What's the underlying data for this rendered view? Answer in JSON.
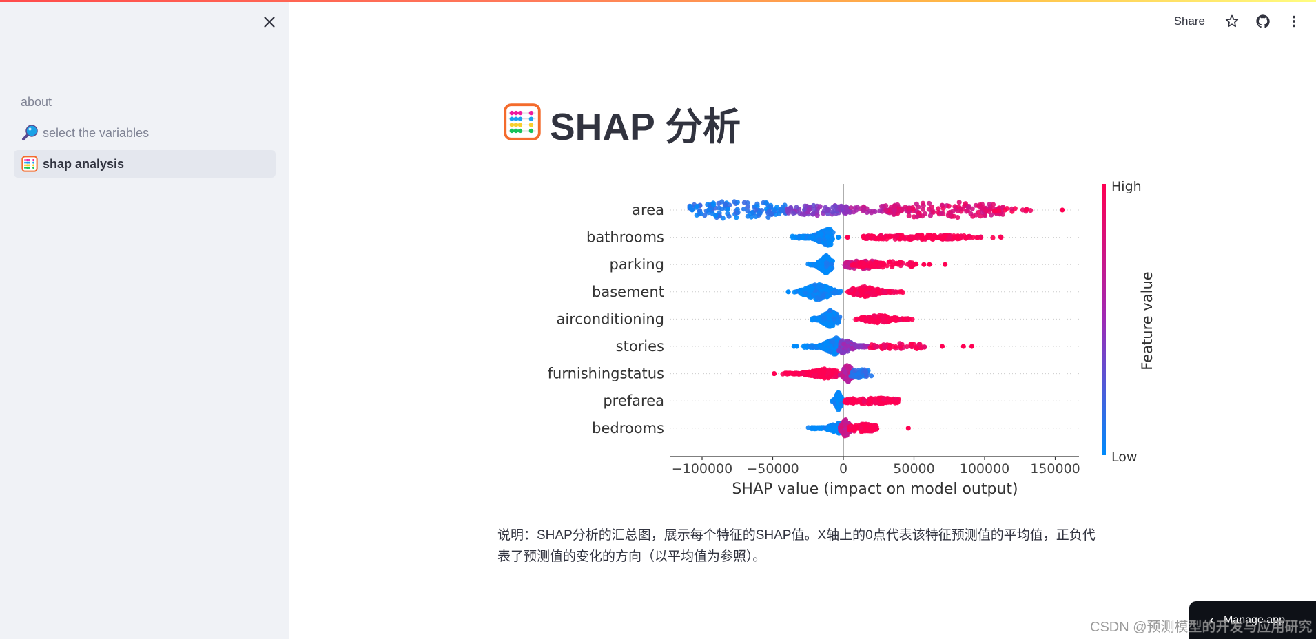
{
  "sidebar": {
    "close_icon": "close-icon",
    "items": [
      {
        "label": "about",
        "icon": "",
        "active": false
      },
      {
        "label": "select the variables",
        "icon": "magnifier-icon",
        "active": false
      },
      {
        "label": "shap analysis",
        "icon": "abacus-icon",
        "active": true
      }
    ]
  },
  "header": {
    "share_label": "Share",
    "icons": [
      "star-icon",
      "github-icon",
      "more-vertical-icon"
    ]
  },
  "page": {
    "title": "SHAP 分析",
    "title_icon": "abacus-icon",
    "description": "说明：SHAP分析的汇总图，展示每个特征的SHAP值。X轴上的0点代表该特征预测值的平均值，正负代表了预测值的变化的方向（以平均值为参照）。"
  },
  "footer": {
    "manage_app_label": "Manage app",
    "watermark": "CSDN @预测模型的开发与应用研究"
  },
  "colors": {
    "low": "#008bfb",
    "mid": "#9e2ab5",
    "high": "#ff0052",
    "accent": "#ff4b4b"
  },
  "chart_data": {
    "type": "scatter",
    "subtype": "shap-beeswarm-summary",
    "xlabel": "SHAP value (impact on model output)",
    "ylabel": "",
    "xlim": [
      -123000,
      166000
    ],
    "xticks": [
      -100000,
      -50000,
      0,
      50000,
      100000,
      150000
    ],
    "xtick_labels": [
      "−100000",
      "−50000",
      "0",
      "50000",
      "100000",
      "150000"
    ],
    "colorbar": {
      "label": "Feature value",
      "high_label": "High",
      "low_label": "Low",
      "placement": "right"
    },
    "features": [
      {
        "name": "area",
        "groups": [
          {
            "from": -109000,
            "to": -40000,
            "n": 130,
            "color": 0.1,
            "spread": 1.0
          },
          {
            "from": -40000,
            "to": 5000,
            "n": 90,
            "color": 0.4,
            "spread": 0.6
          },
          {
            "from": 5000,
            "to": 50000,
            "n": 40,
            "color": 0.65,
            "spread": 0.45
          },
          {
            "from": 30000,
            "to": 115000,
            "n": 140,
            "color": 0.82,
            "spread": 0.9
          },
          {
            "from": 100000,
            "to": 135000,
            "n": 18,
            "color": 0.95,
            "spread": 0.2
          }
        ],
        "outliers": [
          {
            "x": -107000,
            "c": 0.05
          },
          {
            "x": 155000,
            "c": 1.0
          }
        ]
      },
      {
        "name": "bathrooms",
        "groups": [
          {
            "from": -38000,
            "to": -7000,
            "n": 200,
            "color": 0.0,
            "spread": 1.0,
            "peak": -10000
          }
        ],
        "outliers": [
          {
            "x": -3500,
            "c": 0.0
          },
          {
            "x": 3000,
            "c": 1.0
          }
        ],
        "groups2": [
          {
            "from": 14000,
            "to": 90000,
            "n": 170,
            "color": 1.0,
            "spread": 0.25
          },
          {
            "from": 90000,
            "to": 112000,
            "n": 8,
            "color": 1.0,
            "spread": 0.1
          }
        ]
      },
      {
        "name": "parking",
        "groups": [
          {
            "from": -26000,
            "to": -7000,
            "n": 200,
            "color": 0.0,
            "spread": 1.0,
            "peak": -12000
          },
          {
            "from": 1000,
            "to": 26000,
            "n": 60,
            "color": 0.72,
            "spread": 0.5
          },
          {
            "from": 6000,
            "to": 53000,
            "n": 70,
            "color": 1.0,
            "spread": 0.35
          }
        ],
        "outliers": [
          {
            "x": 57000,
            "c": 1.0
          },
          {
            "x": 61000,
            "c": 1.0
          },
          {
            "x": 72000,
            "c": 1.0
          }
        ]
      },
      {
        "name": "basement",
        "groups": [
          {
            "from": -36000,
            "to": -500,
            "n": 220,
            "color": 0.0,
            "spread": 0.9,
            "peak": -18000
          },
          {
            "from": 2500,
            "to": 43000,
            "n": 130,
            "color": 1.0,
            "spread": 0.6,
            "peak": 15000
          }
        ],
        "outliers": [
          {
            "x": -39000,
            "c": 0.0
          }
        ]
      },
      {
        "name": "airconditioning",
        "groups": [
          {
            "from": -23000,
            "to": -2000,
            "n": 220,
            "color": 0.0,
            "spread": 1.0,
            "peak": -9000
          },
          {
            "from": 8000,
            "to": 50000,
            "n": 150,
            "color": 1.0,
            "spread": 0.45,
            "peak": 25000
          }
        ],
        "outliers": []
      },
      {
        "name": "stories",
        "groups": [
          {
            "from": -30000,
            "to": -2000,
            "n": 160,
            "color": 0.0,
            "spread": 1.0,
            "peak": -5000
          },
          {
            "from": -5000,
            "to": 20000,
            "n": 110,
            "color": 0.45,
            "spread": 0.8,
            "peak": 0
          },
          {
            "from": 18000,
            "to": 58000,
            "n": 50,
            "color": 0.95,
            "spread": 0.35
          }
        ],
        "outliers": [
          {
            "x": -33000,
            "c": 0.0
          },
          {
            "x": -35000,
            "c": 0.0
          },
          {
            "x": 70000,
            "c": 1.0
          },
          {
            "x": 85000,
            "c": 1.0
          },
          {
            "x": 91000,
            "c": 1.0
          }
        ]
      },
      {
        "name": "furnishingstatus",
        "groups": [
          {
            "from": -45000,
            "to": -1000,
            "n": 190,
            "color": 1.0,
            "spread": 0.55,
            "peak": -12000
          },
          {
            "from": -3000,
            "to": 12000,
            "n": 90,
            "color": 0.65,
            "spread": 1.0,
            "peak": 3000
          },
          {
            "from": 5000,
            "to": 20000,
            "n": 40,
            "color": 0.1,
            "spread": 0.5
          }
        ],
        "outliers": [
          {
            "x": -49000,
            "c": 1.0
          }
        ]
      },
      {
        "name": "prefarea",
        "groups": [
          {
            "from": -8000,
            "to": 0,
            "n": 150,
            "color": 0.0,
            "spread": 1.0,
            "peak": -3500
          },
          {
            "from": 1000,
            "to": 39000,
            "n": 120,
            "color": 1.0,
            "spread": 0.35
          }
        ],
        "outliers": []
      },
      {
        "name": "bedrooms",
        "groups": [
          {
            "from": -25000,
            "to": -1000,
            "n": 120,
            "color": 0.0,
            "spread": 0.6,
            "peak": -3000
          },
          {
            "from": -3000,
            "to": 9000,
            "n": 140,
            "color": 0.7,
            "spread": 1.0,
            "peak": 1500
          },
          {
            "from": 4000,
            "to": 24000,
            "n": 80,
            "color": 1.0,
            "spread": 0.45
          }
        ],
        "outliers": [
          {
            "x": 46000,
            "c": 1.0
          }
        ]
      }
    ]
  }
}
